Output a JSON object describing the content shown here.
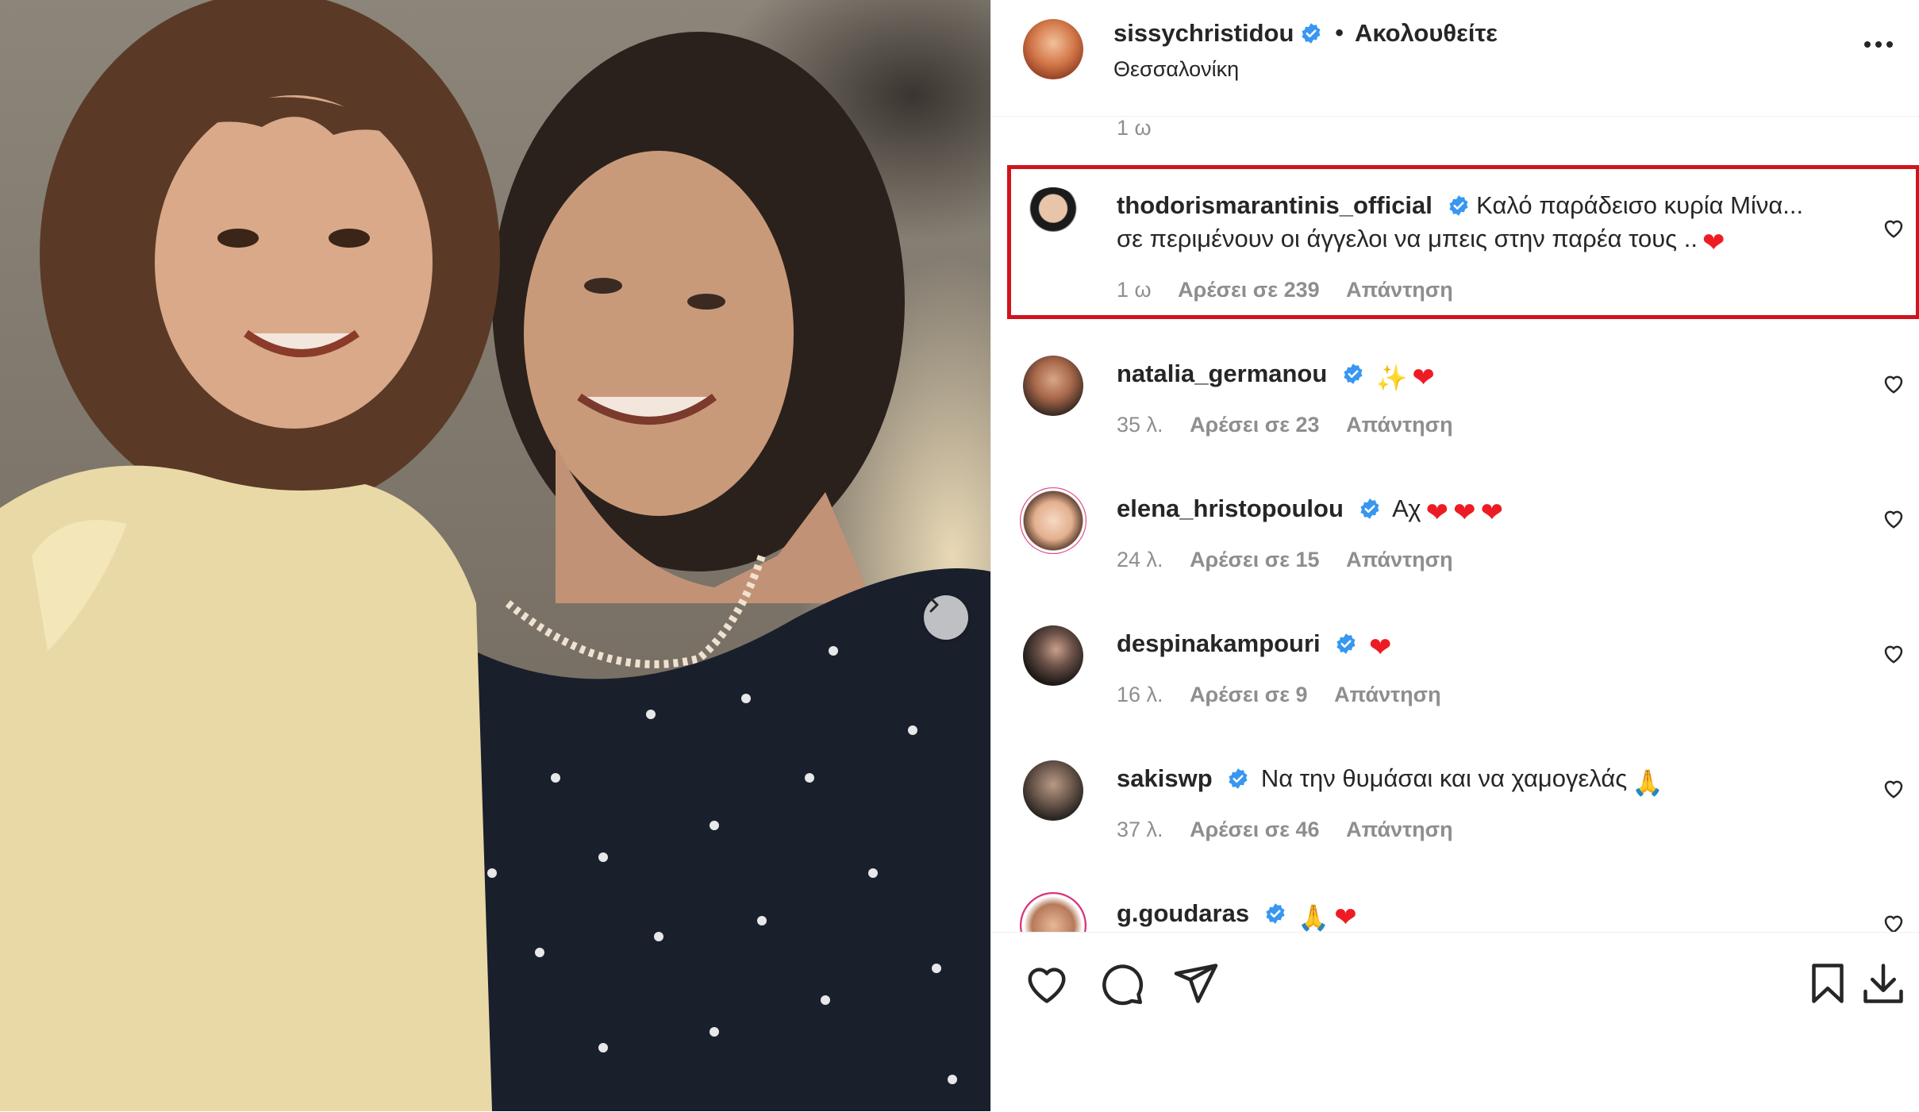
{
  "post_header": {
    "username": "sissychristidou",
    "separator": "•",
    "follow_status": "Ακολουθείτε",
    "location": "Θεσσαλονίκη",
    "more_icon": "more-horizontal-icon"
  },
  "top_time": "1 ω",
  "comments": [
    {
      "username": "thodorismarantinis_official",
      "text": "Καλό παράδεισο κυρία Μίνα... σε περιμένουν οι άγγελοι να μπεις στην παρέα τους ..",
      "emoji": [
        "❤"
      ],
      "time": "1 ω",
      "likes": "Αρέσει σε 239",
      "reply": "Απάντηση",
      "highlighted": true
    },
    {
      "username": "natalia_germanou",
      "text": "",
      "emoji": [
        "✨",
        "❤"
      ],
      "time": "35 λ.",
      "likes": "Αρέσει σε 23",
      "reply": "Απάντηση"
    },
    {
      "username": "elena_hristopoulou",
      "text": "Αχ",
      "emoji": [
        "❤",
        "❤",
        "❤"
      ],
      "time": "24 λ.",
      "likes": "Αρέσει σε 15",
      "reply": "Απάντηση"
    },
    {
      "username": "despinakampouri",
      "text": "",
      "emoji": [
        "❤"
      ],
      "time": "16 λ.",
      "likes": "Αρέσει σε 9",
      "reply": "Απάντηση"
    },
    {
      "username": "sakiswp",
      "text": "Να την θυμάσαι και να χαμογελάς",
      "emoji": [
        "🙏"
      ],
      "time": "37 λ.",
      "likes": "Αρέσει σε 46",
      "reply": "Απάντηση"
    },
    {
      "username": "g.goudaras",
      "text": "",
      "emoji": [
        "🙏",
        "❤"
      ],
      "time": "",
      "likes": "",
      "reply": ""
    }
  ],
  "actions": {
    "like_icon": "heart-icon",
    "comment_icon": "comment-icon",
    "share_icon": "send-icon",
    "save_icon": "bookmark-icon",
    "download_icon": "download-icon"
  },
  "colors": {
    "verified": "#3897f0",
    "heart_red": "#ed1c24",
    "highlight_border": "#d0141c",
    "muted_text": "#8e8e8e"
  }
}
